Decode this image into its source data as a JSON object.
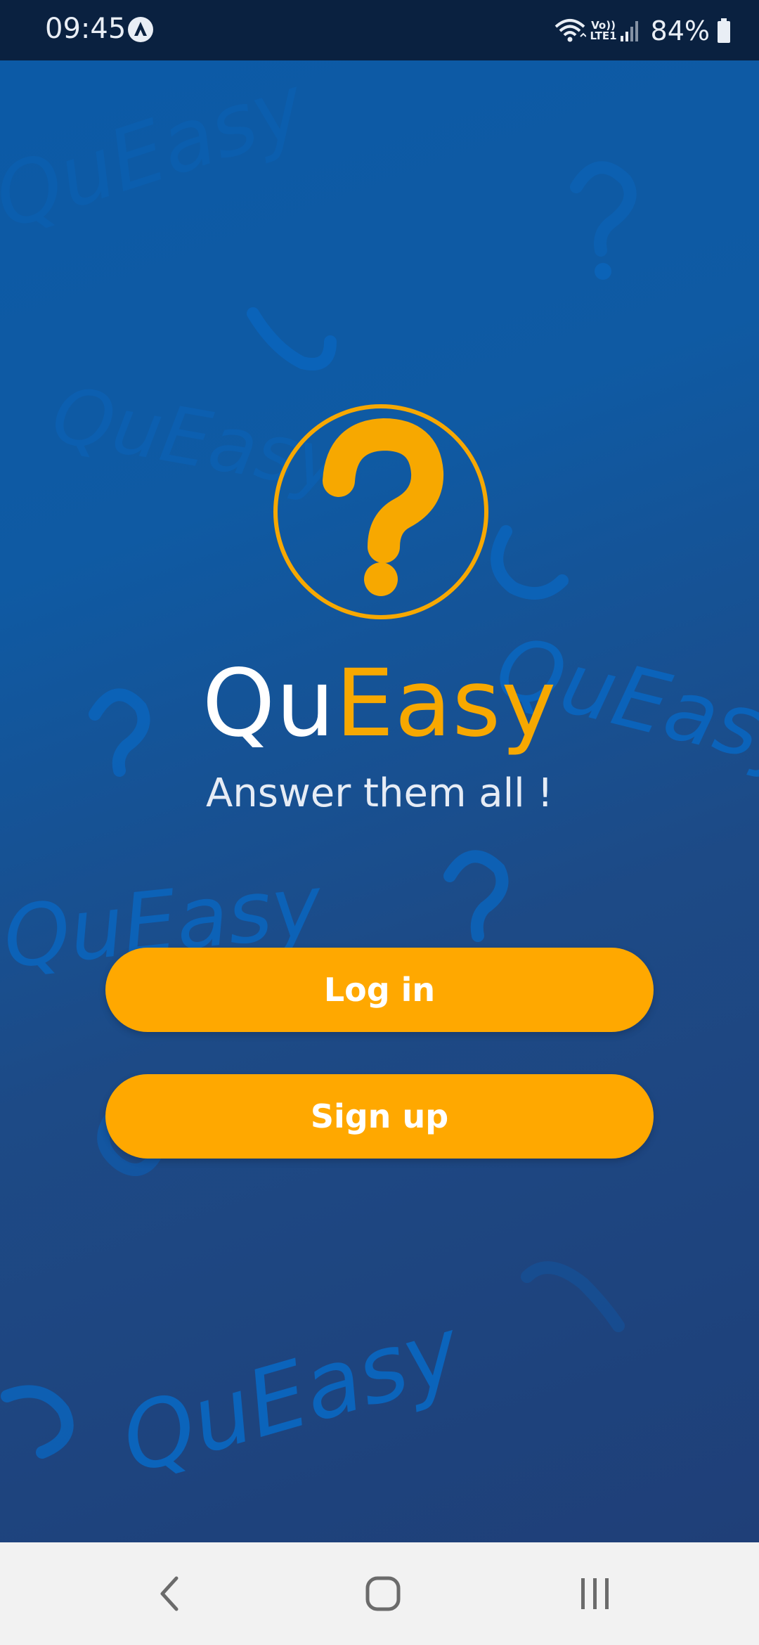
{
  "status_bar": {
    "time": "09:45",
    "app_icon": "app-notification-icon",
    "network_label_top": "Vo))",
    "network_label_bottom": "LTE1",
    "battery_percent": "84%",
    "icons": [
      "wifi-icon",
      "signal-icon",
      "battery-icon"
    ]
  },
  "app": {
    "title_part1": "Qu",
    "title_part2": "Easy",
    "tagline": "Answer them all !",
    "logo_icon": "question-mark-logo-icon",
    "colors": {
      "accent": "#f7a800",
      "button": "#ffa800",
      "background_top": "#0c5aa6",
      "background_bottom": "#1f3f78",
      "status_bar": "#0a2140"
    }
  },
  "actions": {
    "login_label": "Log in",
    "signup_label": "Sign up"
  },
  "background_decor": {
    "watermark_text": "QuEasy",
    "watermark_icon": "question-mark-icon"
  },
  "nav_bar": {
    "items": [
      "back-icon",
      "home-icon",
      "recents-icon"
    ]
  }
}
